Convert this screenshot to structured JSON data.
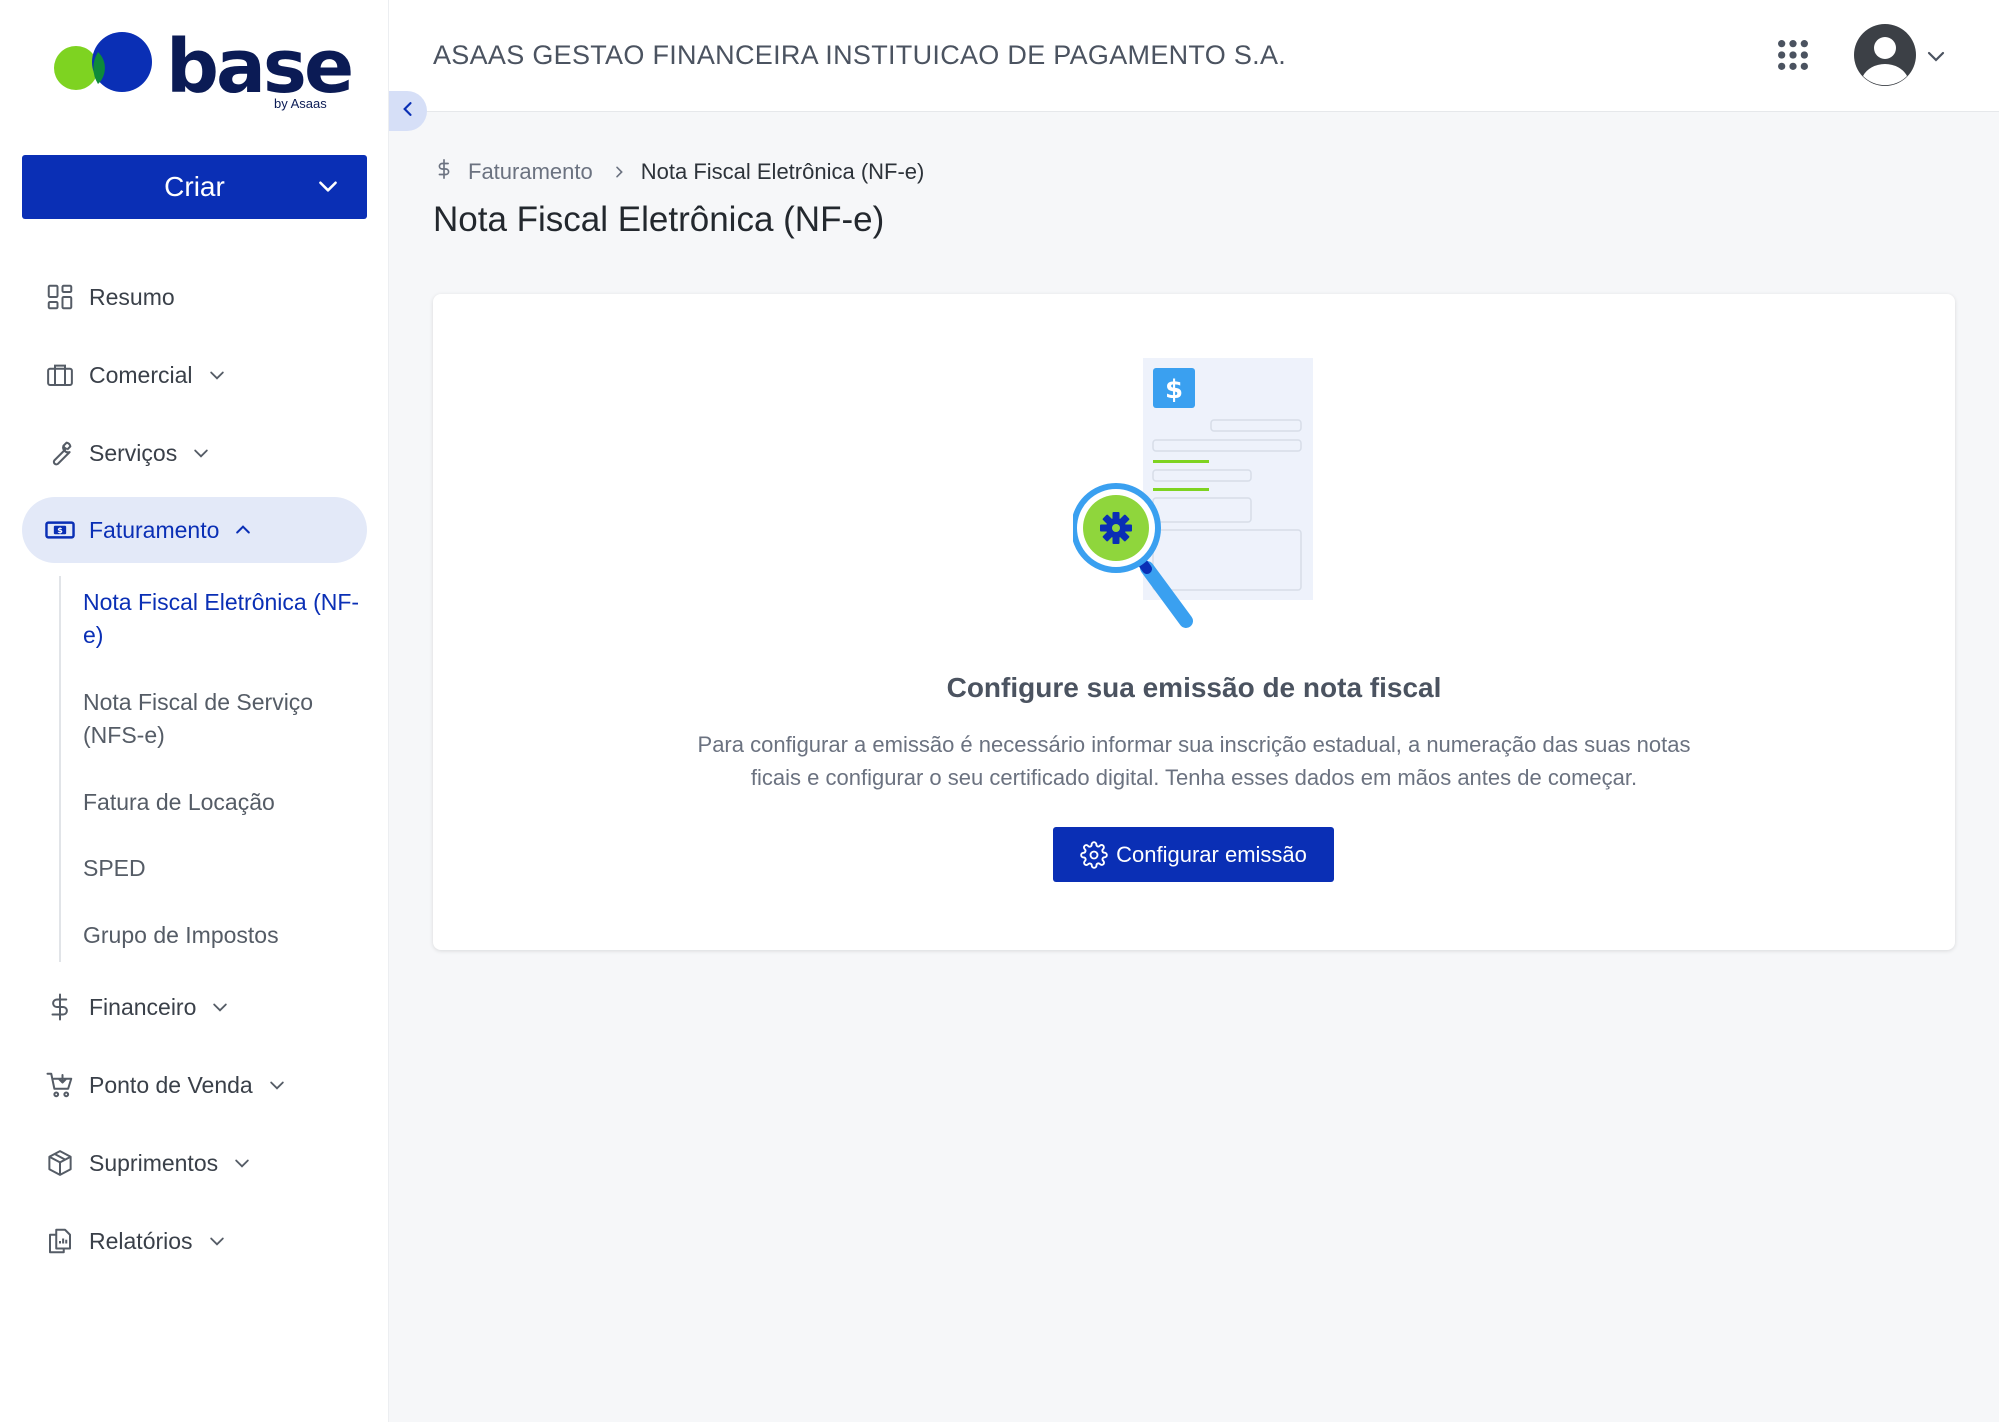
{
  "logo": {
    "word": "base",
    "sub": "by Asaas"
  },
  "sidebar": {
    "create_label": "Criar",
    "items": [
      {
        "label": "Resumo",
        "icon": "dashboard-icon"
      },
      {
        "label": "Comercial",
        "icon": "briefcase-icon"
      },
      {
        "label": "Serviços",
        "icon": "wrench-icon"
      },
      {
        "label": "Faturamento",
        "icon": "banknote-icon"
      },
      {
        "label": "Financeiro",
        "icon": "dollar-icon"
      },
      {
        "label": "Ponto de Venda",
        "icon": "cart-icon"
      },
      {
        "label": "Suprimentos",
        "icon": "box-icon"
      },
      {
        "label": "Relatórios",
        "icon": "reports-icon"
      }
    ],
    "sub_items": [
      {
        "label": "Nota Fiscal Eletrônica (NF-e)"
      },
      {
        "label": "Nota Fiscal de Serviço (NFS-e)"
      },
      {
        "label": "Fatura de Locação"
      },
      {
        "label": "SPED"
      },
      {
        "label": "Grupo de Impostos"
      }
    ]
  },
  "header": {
    "company": "ASAAS GESTAO FINANCEIRA INSTITUICAO DE PAGAMENTO S.A."
  },
  "breadcrumb": {
    "parent": "Faturamento",
    "current": "Nota Fiscal Eletrônica (NF-e)"
  },
  "page": {
    "title": "Nota Fiscal Eletrônica (NF-e)"
  },
  "card": {
    "title": "Configure sua emissão de nota fiscal",
    "description": "Para configurar a emissão é necessário informar sua inscrição estadual, a numeração das suas notas ficais e configurar o seu certificado digital. Tenha esses dados em mãos antes de começar.",
    "button_label": "Configurar emissão"
  },
  "colors": {
    "primary": "#0a2fb5",
    "active_bg": "#e3e9f8",
    "logo_green": "#7ed321",
    "logo_blue": "#0a2fb5",
    "illus_blue": "#3aa0f0"
  }
}
